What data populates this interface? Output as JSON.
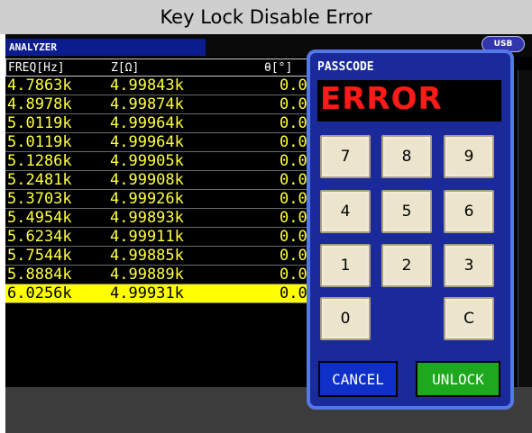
{
  "title": "Key Lock Disable Error",
  "header": {
    "mode": "ANALYZER",
    "usb_label": "USB"
  },
  "table": {
    "columns": [
      "FREQ[Hz]",
      "Z[Ω]",
      "θ[°]"
    ],
    "rows": [
      [
        "4.7863k",
        "4.99843k",
        "0.0"
      ],
      [
        "4.8978k",
        "4.99874k",
        "0.0"
      ],
      [
        "5.0119k",
        "4.99964k",
        "0.0"
      ],
      [
        "5.0119k",
        "4.99964k",
        "0.0"
      ],
      [
        "5.1286k",
        "4.99905k",
        "0.0"
      ],
      [
        "5.2481k",
        "4.99908k",
        "0.0"
      ],
      [
        "5.3703k",
        "4.99926k",
        "0.0"
      ],
      [
        "5.4954k",
        "4.99893k",
        "0.0"
      ],
      [
        "5.6234k",
        "4.99911k",
        "0.0"
      ],
      [
        "5.7544k",
        "4.99885k",
        "0.0"
      ],
      [
        "5.8884k",
        "4.99889k",
        "0.0"
      ],
      [
        "6.0256k",
        "4.99931k",
        "0.0"
      ]
    ],
    "selected_row": 11
  },
  "dialog": {
    "title": "PASSCODE",
    "display": "ERROR",
    "keys": [
      "7",
      "8",
      "9",
      "4",
      "5",
      "6",
      "1",
      "2",
      "3",
      "0",
      "C"
    ],
    "cancel_label": "CANCEL",
    "unlock_label": "UNLOCK"
  },
  "colors": {
    "accent_blue": "#1a2a9a",
    "error_red": "#ff1a1a",
    "data_yellow": "#ffff40",
    "unlock_green": "#1ea81e"
  }
}
